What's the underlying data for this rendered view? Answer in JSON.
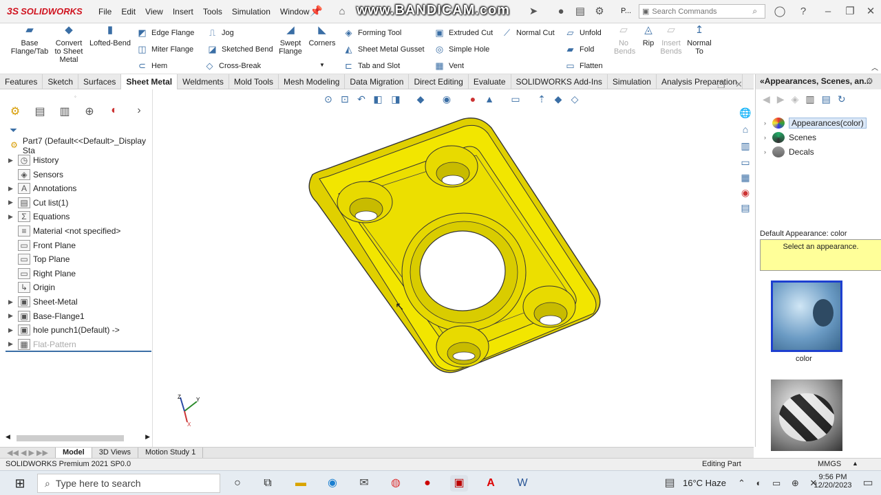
{
  "app": {
    "name": "SOLIDWORKS",
    "logo_prefix": "3S"
  },
  "menus": [
    "File",
    "Edit",
    "View",
    "Insert",
    "Tools",
    "Simulation",
    "Window"
  ],
  "watermark": "www.BANDICAM.com",
  "titlebar_extra": "P...",
  "search": {
    "placeholder": "Search Commands"
  },
  "command_manager": {
    "big": [
      {
        "label": "Base\nFlange/Tab",
        "icon": "base-flange-icon"
      },
      {
        "label": "Convert\nto Sheet\nMetal",
        "icon": "convert-icon"
      },
      {
        "label": "Lofted-Bend",
        "icon": "lofted-bend-icon"
      },
      {
        "label": "Swept\nFlange",
        "icon": "swept-flange-icon"
      },
      {
        "label": "Corners",
        "icon": "corners-icon"
      },
      {
        "label": "No\nBends",
        "icon": "no-bends-icon",
        "disabled": true
      },
      {
        "label": "Rip",
        "icon": "rip-icon"
      },
      {
        "label": "Insert\nBends",
        "icon": "insert-bends-icon",
        "disabled": true
      },
      {
        "label": "Normal\nTo",
        "icon": "normal-to-icon"
      }
    ],
    "small": [
      {
        "label": "Edge Flange",
        "icon": "edge-flange-icon"
      },
      {
        "label": "Miter Flange",
        "icon": "miter-flange-icon"
      },
      {
        "label": "Hem",
        "icon": "hem-icon"
      },
      {
        "label": "Jog",
        "icon": "jog-icon"
      },
      {
        "label": "Sketched Bend",
        "icon": "sketched-bend-icon"
      },
      {
        "label": "Cross-Break",
        "icon": "cross-break-icon"
      },
      {
        "label": "Forming Tool",
        "icon": "forming-tool-icon"
      },
      {
        "label": "Sheet Metal Gusset",
        "icon": "gusset-icon"
      },
      {
        "label": "Tab and Slot",
        "icon": "tab-slot-icon"
      },
      {
        "label": "Extruded Cut",
        "icon": "extruded-cut-icon"
      },
      {
        "label": "Simple Hole",
        "icon": "simple-hole-icon"
      },
      {
        "label": "Vent",
        "icon": "vent-icon"
      },
      {
        "label": "Normal Cut",
        "icon": "normal-cut-icon"
      },
      {
        "label": "Unfold",
        "icon": "unfold-icon"
      },
      {
        "label": "Fold",
        "icon": "fold-icon"
      },
      {
        "label": "Flatten",
        "icon": "flatten-icon"
      }
    ]
  },
  "tabs": [
    "Features",
    "Sketch",
    "Surfaces",
    "Sheet Metal",
    "Weldments",
    "Mold Tools",
    "Mesh Modeling",
    "Data Migration",
    "Direct Editing",
    "Evaluate",
    "SOLIDWORKS Add-Ins",
    "Simulation",
    "Analysis Preparation"
  ],
  "active_tab": "Sheet Metal",
  "tree": {
    "root": "Part7  (Default<<Default>_Display Sta",
    "nodes": [
      {
        "label": "History",
        "expandable": true
      },
      {
        "label": "Sensors",
        "expandable": false
      },
      {
        "label": "Annotations",
        "expandable": true
      },
      {
        "label": "Cut list(1)",
        "expandable": true
      },
      {
        "label": "Equations",
        "expandable": true
      },
      {
        "label": "Material <not specified>",
        "expandable": false
      },
      {
        "label": "Front Plane",
        "expandable": false
      },
      {
        "label": "Top Plane",
        "expandable": false
      },
      {
        "label": "Right Plane",
        "expandable": false
      },
      {
        "label": "Origin",
        "expandable": false
      },
      {
        "label": "Sheet-Metal",
        "expandable": true
      },
      {
        "label": "Base-Flange1",
        "expandable": true
      },
      {
        "label": "hole punch1(Default) ->",
        "expandable": true
      },
      {
        "label": "Flat-Pattern",
        "expandable": true,
        "suppressed": true
      }
    ]
  },
  "task_pane": {
    "title": "Appearances, Scenes, an...",
    "nodes": [
      {
        "label": "Appearances(color)",
        "selected": true
      },
      {
        "label": "Scenes"
      },
      {
        "label": "Decals"
      }
    ],
    "default_label": "Default Appearance: color",
    "hint": "Select an appearance.",
    "swatch_label": "color"
  },
  "bottom_tabs": [
    "Model",
    "3D Views",
    "Motion Study 1"
  ],
  "active_bottom_tab": "Model",
  "status": {
    "left": "SOLIDWORKS Premium 2021 SP0.0",
    "mode": "Editing Part",
    "units": "MMGS"
  },
  "taskbar": {
    "search_placeholder": "Type here to search",
    "weather": "16°C  Haze",
    "time": "9:56 PM",
    "date": "12/20/2023"
  },
  "colors": {
    "part": "#f2e600",
    "brand": "#d0131f",
    "accent": "#3a6ea5"
  }
}
